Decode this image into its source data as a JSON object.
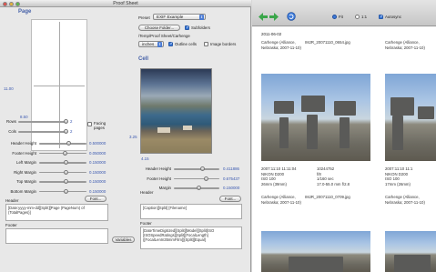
{
  "window_title": "Proof Sheet",
  "page_section": {
    "title": "Page",
    "height_readout": "11.00",
    "width_readout": "8.50",
    "rows": {
      "label": "Rows",
      "value": "2"
    },
    "cols": {
      "label": "Cols",
      "value": "2"
    },
    "facing_pages": {
      "label": "Facing pages",
      "checked": false
    },
    "margins": [
      {
        "label": "Header Height",
        "value": "0.500000"
      },
      {
        "label": "Footer Height",
        "value": "0.050000"
      },
      {
        "label": "Left Margin",
        "value": "0.150000"
      },
      {
        "label": "Right Margin",
        "value": "0.150000"
      },
      {
        "label": "Top Margin",
        "value": "0.150000"
      },
      {
        "label": "Bottom Margin",
        "value": "0.150000"
      }
    ],
    "header_label": "Header",
    "header_font_button": "Font...",
    "header_text": "[Date:yyyy-mm-dd][Split][Page (PageNum) of (TotalPages)]",
    "footer_label": "Footer",
    "footer_text": "",
    "variables_button": "Variables"
  },
  "top_controls": {
    "preset_label": "Preset",
    "preset_value": "EXIF Example",
    "choose_folder_button": "Choose Folder...",
    "subfolders": {
      "label": "Subfolders",
      "checked": true
    },
    "folder_path": "/Temp/Proof Sheet/Carhenge",
    "units_value": "inches",
    "outline_cells": {
      "label": "Outline cells",
      "checked": true
    },
    "image_borders": {
      "label": "Image borders",
      "checked": false
    }
  },
  "cell_section": {
    "title": "Cell",
    "height_readout": "3.25",
    "width_readout": "4.15",
    "sliders": [
      {
        "label": "Header Height",
        "value": "0.411886"
      },
      {
        "label": "Footer Height",
        "value": "0.675437"
      },
      {
        "label": "Margin",
        "value": "0.150000"
      }
    ],
    "header_label": "Header",
    "header_font_button": "Font...",
    "header_text": "[Caption][Split] [Filename]",
    "footer_label": "Footer",
    "footer_text": "[DateTimeDigitized][Split][Model][Split]ISO [ISOSpeedRatings][Split][FocalLength] ([FocalLenIn35mmFilm])[Split][Equal]"
  },
  "preview_window": {
    "fit_label": "Fit",
    "one_to_one_label": "1:1",
    "autosync": {
      "label": "Autosync",
      "checked": true
    },
    "date_header": "2011-06-02",
    "cells": [
      {
        "header_left": "Carhenge (Alliance, Nebraska; 2007-11-10)",
        "header_right": "IMJR_20071110_0654.jpg",
        "footer_left": "2007:11:10 11:11:04\nNIKON D200\nISO 100\n26mm (39mm)",
        "footer_right": "10244752\nf/8\n1/160 sec\n17.0-55.0 mm f/2.8"
      },
      {
        "header_left": "Carhenge (Alliance, Nebraska; 2007-11-10)",
        "header_right": "",
        "footer_left": "2007:11:10 11:1\nNIKON D200\nISO 100\n17mm (26mm)",
        "footer_right": ""
      },
      {
        "header_left": "Carhenge (Alliance, Nebraska; 2007-11-10)",
        "header_right": "IMJR_20071110_0709.jpg",
        "footer_left": "",
        "footer_right": ""
      },
      {
        "header_left": "Carhenge (Alliance, Nebraska; 2007-11-10)",
        "header_right": "",
        "footer_left": "",
        "footer_right": ""
      }
    ]
  },
  "colors": {
    "accent_blue": "#3a58b0",
    "section_title": "#4560a8",
    "toolbar_green": "#3aa64a"
  }
}
